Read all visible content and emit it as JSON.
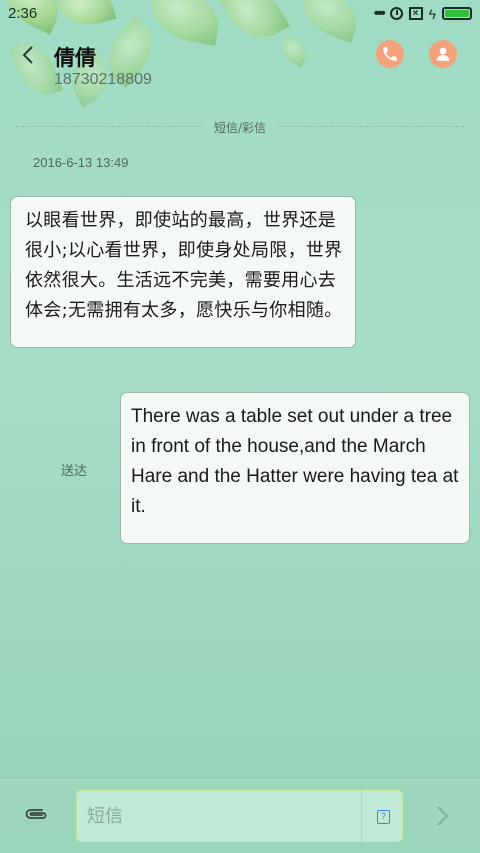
{
  "status_bar": {
    "time": "2:36",
    "icons": [
      "more-dots-icon",
      "alarm-icon",
      "no-sim-icon",
      "charging-bolt-icon",
      "battery-icon"
    ],
    "battery_level": 1.0,
    "battery_color": "#2fc23a"
  },
  "header": {
    "contact_name": "倩倩",
    "contact_number": "18730218809",
    "back_icon": "chevron-left-icon",
    "call_icon": "phone-icon",
    "profile_icon": "person-icon",
    "accent_color": "#f3a37b"
  },
  "conversation": {
    "divider_label": "短信/彩信",
    "timestamp": "2016-6-13 13:49",
    "incoming_message": "以眼看世界，即使站的最高，世界还是很小;以心看世界，即使身处局限，世界依然很大。生活远不完美，需要用心去体会;无需拥有太多，愿快乐与你相随。",
    "outgoing_message": "There was a table set out under a tree in front of the house,and the March Hare and the Hatter were having tea at it.",
    "outgoing_status": "送达"
  },
  "composer": {
    "placeholder": "短信",
    "attach_icon": "paperclip-icon",
    "sim_icon": "sim-select-icon",
    "sim_label": "?",
    "send_icon": "chevron-right-icon"
  }
}
